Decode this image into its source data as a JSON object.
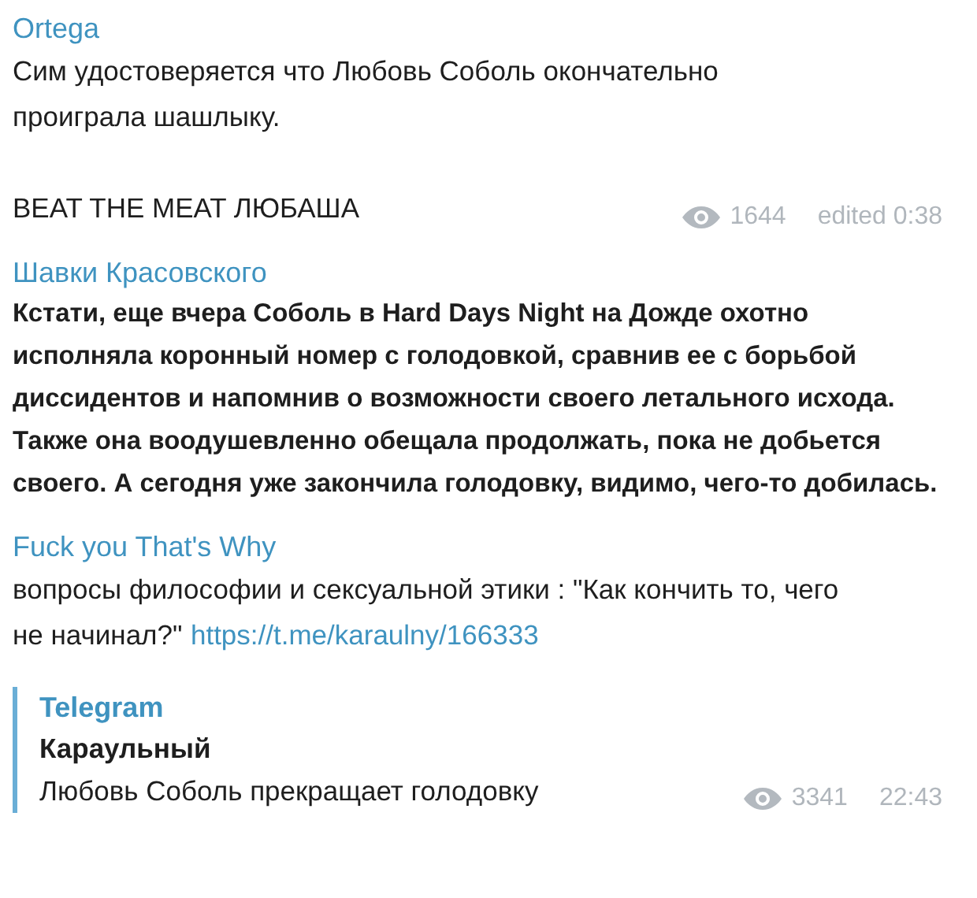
{
  "messages": [
    {
      "author": "Ortega",
      "bold": false,
      "paragraphs": [
        "Сим удостоверяется что Любовь Соболь окончательно проиграла шашлыку.",
        "BEAT THE MEAT ЛЮБАША"
      ],
      "views": "1644",
      "time": "edited 0:38"
    },
    {
      "author": "Шавки Красовского",
      "bold": true,
      "paragraphs": [
        "Кстати, еще вчера Соболь в Hard Days Night на Дожде охотно исполняла коронный номер с голодовкой, сравнив ее с борьбой диссидентов и напомнив о возможности своего летального исхода. Также она воодушевленно обещала продолжать, пока не добьется своего. А сегодня уже закончила голодовку, видимо, чего-то добилась."
      ]
    },
    {
      "author": "Fuck you That's Why",
      "bold": false,
      "paragraphs": [
        "вопросы философии и сексуальной этики : \"Как кончить то, чего не начинал?\""
      ],
      "link": "https://t.me/karaulny/166333",
      "preview": {
        "site": "Telegram",
        "title": "Караульный",
        "description": "Любовь Соболь прекращает голодовку"
      },
      "views": "3341",
      "time": "22:43"
    }
  ]
}
